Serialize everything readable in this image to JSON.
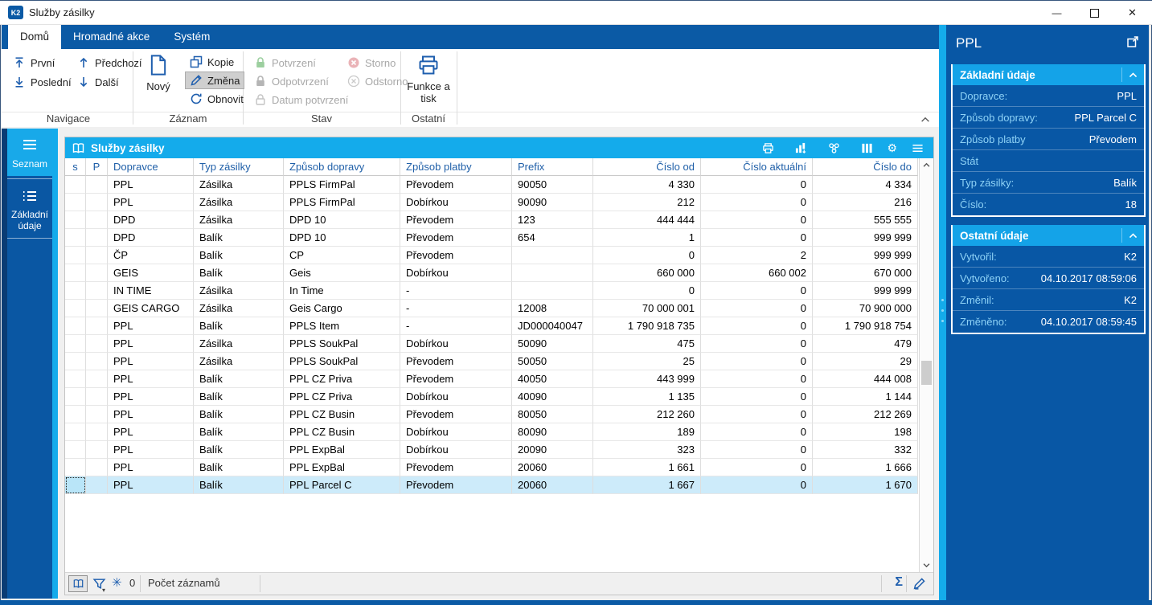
{
  "colors": {
    "accent": "#14abeb",
    "primary": "#0b5aa5",
    "panel": "#0857a5",
    "icon": "#1e5eae",
    "selection": "#cdebfa",
    "confirm_green": "#93cf9f",
    "cancel_red": "#e9a9ad"
  },
  "window": {
    "title": "Služby zásilky",
    "logo": "K2"
  },
  "ribbon": {
    "tabs": [
      {
        "label": "Domů"
      },
      {
        "label": "Hromadné akce"
      },
      {
        "label": "Systém"
      }
    ],
    "buttons": {
      "first": "První",
      "last": "Poslední",
      "prev": "Předchozí",
      "next": "Další",
      "new": "Nový",
      "copy": "Kopie",
      "change": "Změna",
      "refresh": "Obnovit",
      "confirm": "Potvrzení",
      "unconfirm": "Odpotvrzení",
      "confirm_date": "Datum potvrzení",
      "cancel": "Storno",
      "uncancel": "Odstorno",
      "functions": "Funkce a tisk"
    },
    "groups": {
      "nav": "Navigace",
      "record": "Záznam",
      "state": "Stav",
      "other": "Ostatní"
    }
  },
  "sidebar": {
    "items": [
      {
        "label": "Seznam"
      },
      {
        "label": "Základní údaje"
      }
    ]
  },
  "table": {
    "title": "Služby zásilky",
    "columns": [
      {
        "label": "s"
      },
      {
        "label": "P"
      },
      {
        "label": "Dopravce"
      },
      {
        "label": "Typ zásilky"
      },
      {
        "label": "Způsob dopravy"
      },
      {
        "label": "Způsob platby"
      },
      {
        "label": "Prefix"
      },
      {
        "label": "Číslo od"
      },
      {
        "label": "Číslo aktuální"
      },
      {
        "label": "Číslo do"
      }
    ],
    "selected_index": 17,
    "rows": [
      [
        "",
        "",
        "PPL",
        "Zásilka",
        "PPLS FirmPal",
        "Převodem",
        "90050",
        "4 330",
        "0",
        "4 334"
      ],
      [
        "",
        "",
        "PPL",
        "Zásilka",
        "PPLS FirmPal",
        "Dobírkou",
        "90090",
        "212",
        "0",
        "216"
      ],
      [
        "",
        "",
        "DPD",
        "Zásilka",
        "DPD 10",
        "Převodem",
        "123",
        "444 444",
        "0",
        "555 555"
      ],
      [
        "",
        "",
        "DPD",
        "Balík",
        "DPD 10",
        "Převodem",
        "654",
        "1",
        "0",
        "999 999"
      ],
      [
        "",
        "",
        "ČP",
        "Balík",
        "CP",
        "Převodem",
        "",
        "0",
        "2",
        "999 999"
      ],
      [
        "",
        "",
        "GEIS",
        "Balík",
        "Geis",
        "Dobírkou",
        "",
        "660 000",
        "660 002",
        "670 000"
      ],
      [
        "",
        "",
        "IN TIME",
        "Zásilka",
        "In Time",
        "-",
        "",
        "0",
        "0",
        "999 999"
      ],
      [
        "",
        "",
        "GEIS CARGO",
        "Zásilka",
        "Geis Cargo",
        "-",
        "12008",
        "70 000 001",
        "0",
        "70 900 000"
      ],
      [
        "",
        "",
        "PPL",
        "Balík",
        "PPLS Item",
        "-",
        "JD000040047",
        "1 790 918 735",
        "0",
        "1 790 918 754"
      ],
      [
        "",
        "",
        "PPL",
        "Zásilka",
        "PPLS SoukPal",
        "Dobírkou",
        "50090",
        "475",
        "0",
        "479"
      ],
      [
        "",
        "",
        "PPL",
        "Zásilka",
        "PPLS SoukPal",
        "Převodem",
        "50050",
        "25",
        "0",
        "29"
      ],
      [
        "",
        "",
        "PPL",
        "Balík",
        "PPL CZ Priva",
        "Převodem",
        "40050",
        "443 999",
        "0",
        "444 008"
      ],
      [
        "",
        "",
        "PPL",
        "Balík",
        "PPL CZ Priva",
        "Dobírkou",
        "40090",
        "1 135",
        "0",
        "1 144"
      ],
      [
        "",
        "",
        "PPL",
        "Balík",
        "PPL CZ Busin",
        "Převodem",
        "80050",
        "212 260",
        "0",
        "212 269"
      ],
      [
        "",
        "",
        "PPL",
        "Balík",
        "PPL CZ Busin",
        "Dobírkou",
        "80090",
        "189",
        "0",
        "198"
      ],
      [
        "",
        "",
        "PPL",
        "Balík",
        "PPL ExpBal",
        "Dobírkou",
        "20090",
        "323",
        "0",
        "332"
      ],
      [
        "",
        "",
        "PPL",
        "Balík",
        "PPL ExpBal",
        "Převodem",
        "20060",
        "1 661",
        "0",
        "1 666"
      ],
      [
        "",
        "",
        "PPL",
        "Balík",
        "PPL Parcel C",
        "Převodem",
        "20060",
        "1 667",
        "0",
        "1 670"
      ]
    ]
  },
  "statusbar": {
    "filter_count": "0",
    "records_label": "Počet záznamů"
  },
  "panel": {
    "title": "PPL",
    "sections": [
      {
        "title": "Základní údaje",
        "fields": [
          {
            "label": "Dopravce:",
            "value": "PPL"
          },
          {
            "label": "Způsob dopravy:",
            "value": "PPL Parcel C"
          },
          {
            "label": "Způsob platby",
            "value": "Převodem"
          },
          {
            "label": "Stát",
            "value": ""
          },
          {
            "label": "Typ zásilky:",
            "value": "Balík"
          },
          {
            "label": "Číslo:",
            "value": "18"
          }
        ]
      },
      {
        "title": "Ostatní údaje",
        "fields": [
          {
            "label": "Vytvořil:",
            "value": "K2"
          },
          {
            "label": "Vytvořeno:",
            "value": "04.10.2017 08:59:06"
          },
          {
            "label": "Změnil:",
            "value": "K2"
          },
          {
            "label": "Změněno:",
            "value": "04.10.2017 08:59:45"
          }
        ]
      }
    ]
  },
  "glyphs": {
    "gear": "⚙",
    "flake": "✳",
    "sigma": "Σ",
    "minimize": "—",
    "close": "✕",
    "caret_down": "▾"
  }
}
